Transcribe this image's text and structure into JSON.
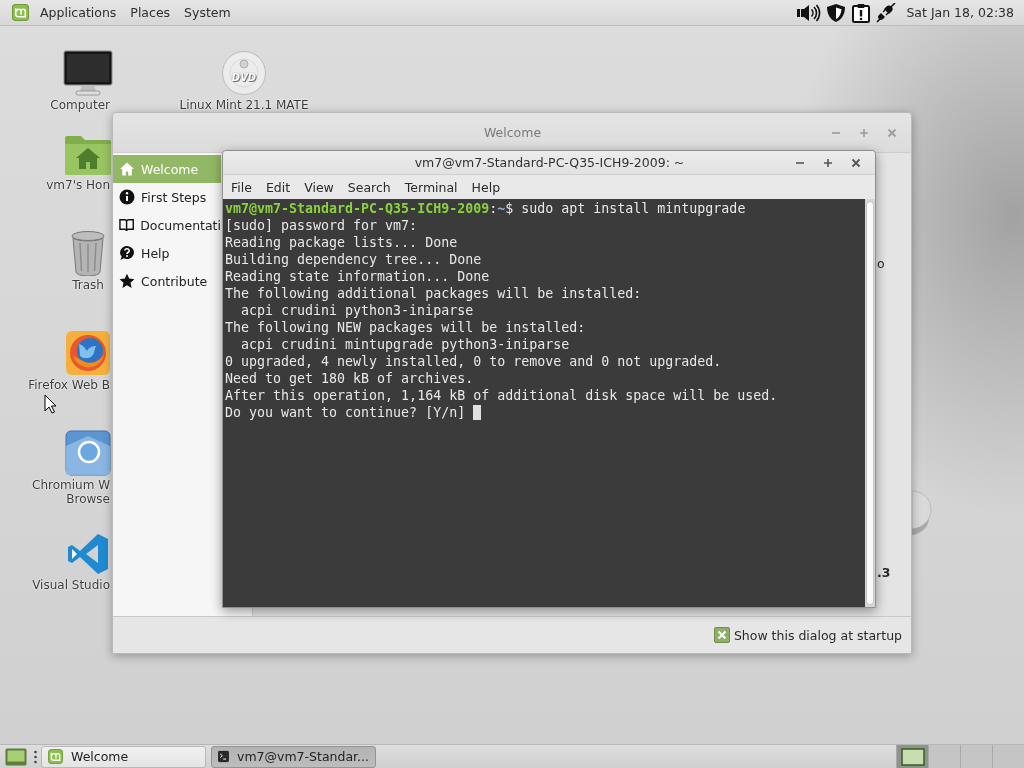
{
  "top_panel": {
    "menus": [
      "Applications",
      "Places",
      "System"
    ],
    "clock": "Sat Jan 18, 02:38"
  },
  "desktop_icon_columns": [
    [
      {
        "kind": "computer",
        "label": "Computer"
      },
      {
        "kind": "home",
        "label": "vm7's Hon"
      },
      {
        "kind": "trash",
        "label": "Trash"
      },
      {
        "kind": "firefox",
        "label": "Firefox Web B"
      },
      {
        "kind": "chromium",
        "label": "Chromium W\nBrowse"
      },
      {
        "kind": "vscode",
        "label": "Visual Studio"
      }
    ],
    [
      {
        "kind": "dvd",
        "label": "Linux Mint 21.1 MATE",
        "logo_text": "DVD"
      }
    ]
  ],
  "welcome_window": {
    "title": "Welcome",
    "sidebar": [
      {
        "kind": "home",
        "label": "Welcome",
        "selected": true
      },
      {
        "kind": "info",
        "label": "First Steps",
        "selected": false
      },
      {
        "kind": "book",
        "label": "Documentati",
        "selected": false
      },
      {
        "kind": "help",
        "label": "Help",
        "selected": false
      },
      {
        "kind": "star",
        "label": "Contribute",
        "selected": false
      }
    ],
    "content_fragments": [
      {
        "text": "o",
        "bold": false
      },
      {
        "text": ".3",
        "bold": true
      }
    ],
    "startup_checkbox": {
      "label": "Show this dialog at startup",
      "checked": true
    }
  },
  "terminal_window": {
    "title": "vm7@vm7-Standard-PC-Q35-ICH9-2009: ~",
    "menu": [
      "File",
      "Edit",
      "View",
      "Search",
      "Terminal",
      "Help"
    ],
    "lines": [
      {
        "kind": "prompt",
        "user_host": "vm7@vm7-Standard-PC-Q35-ICH9-2009",
        "separator": ":",
        "path": "~",
        "prompt_sign": "$",
        "command": "sudo apt install mintupgrade"
      },
      {
        "kind": "output",
        "text": "[sudo] password for vm7:"
      },
      {
        "kind": "output",
        "text": "Reading package lists... Done"
      },
      {
        "kind": "output",
        "text": "Building dependency tree... Done"
      },
      {
        "kind": "output",
        "text": "Reading state information... Done"
      },
      {
        "kind": "output",
        "text": "The following additional packages will be installed:"
      },
      {
        "kind": "indented",
        "text": "acpi crudini python3-iniparse"
      },
      {
        "kind": "output",
        "text": "The following NEW packages will be installed:"
      },
      {
        "kind": "indented",
        "text": "acpi crudini mintupgrade python3-iniparse"
      },
      {
        "kind": "output",
        "text": "0 upgraded, 4 newly installed, 0 to remove and 0 not upgraded."
      },
      {
        "kind": "output",
        "text": "Need to get 180 kB of archives."
      },
      {
        "kind": "output",
        "text": "After this operation, 1,164 kB of additional disk space will be used."
      },
      {
        "kind": "question",
        "text": "Do you want to continue? [Y/n]"
      }
    ]
  },
  "taskbar": {
    "tasks": [
      {
        "kind": "mint",
        "label": "Welcome",
        "selected": false
      },
      {
        "kind": "terminal",
        "label": "vm7@vm7-Standar...",
        "selected": true
      }
    ],
    "workspaces": [
      {
        "selected": true
      },
      {
        "selected": false
      },
      {
        "selected": false
      },
      {
        "selected": false
      }
    ]
  }
}
